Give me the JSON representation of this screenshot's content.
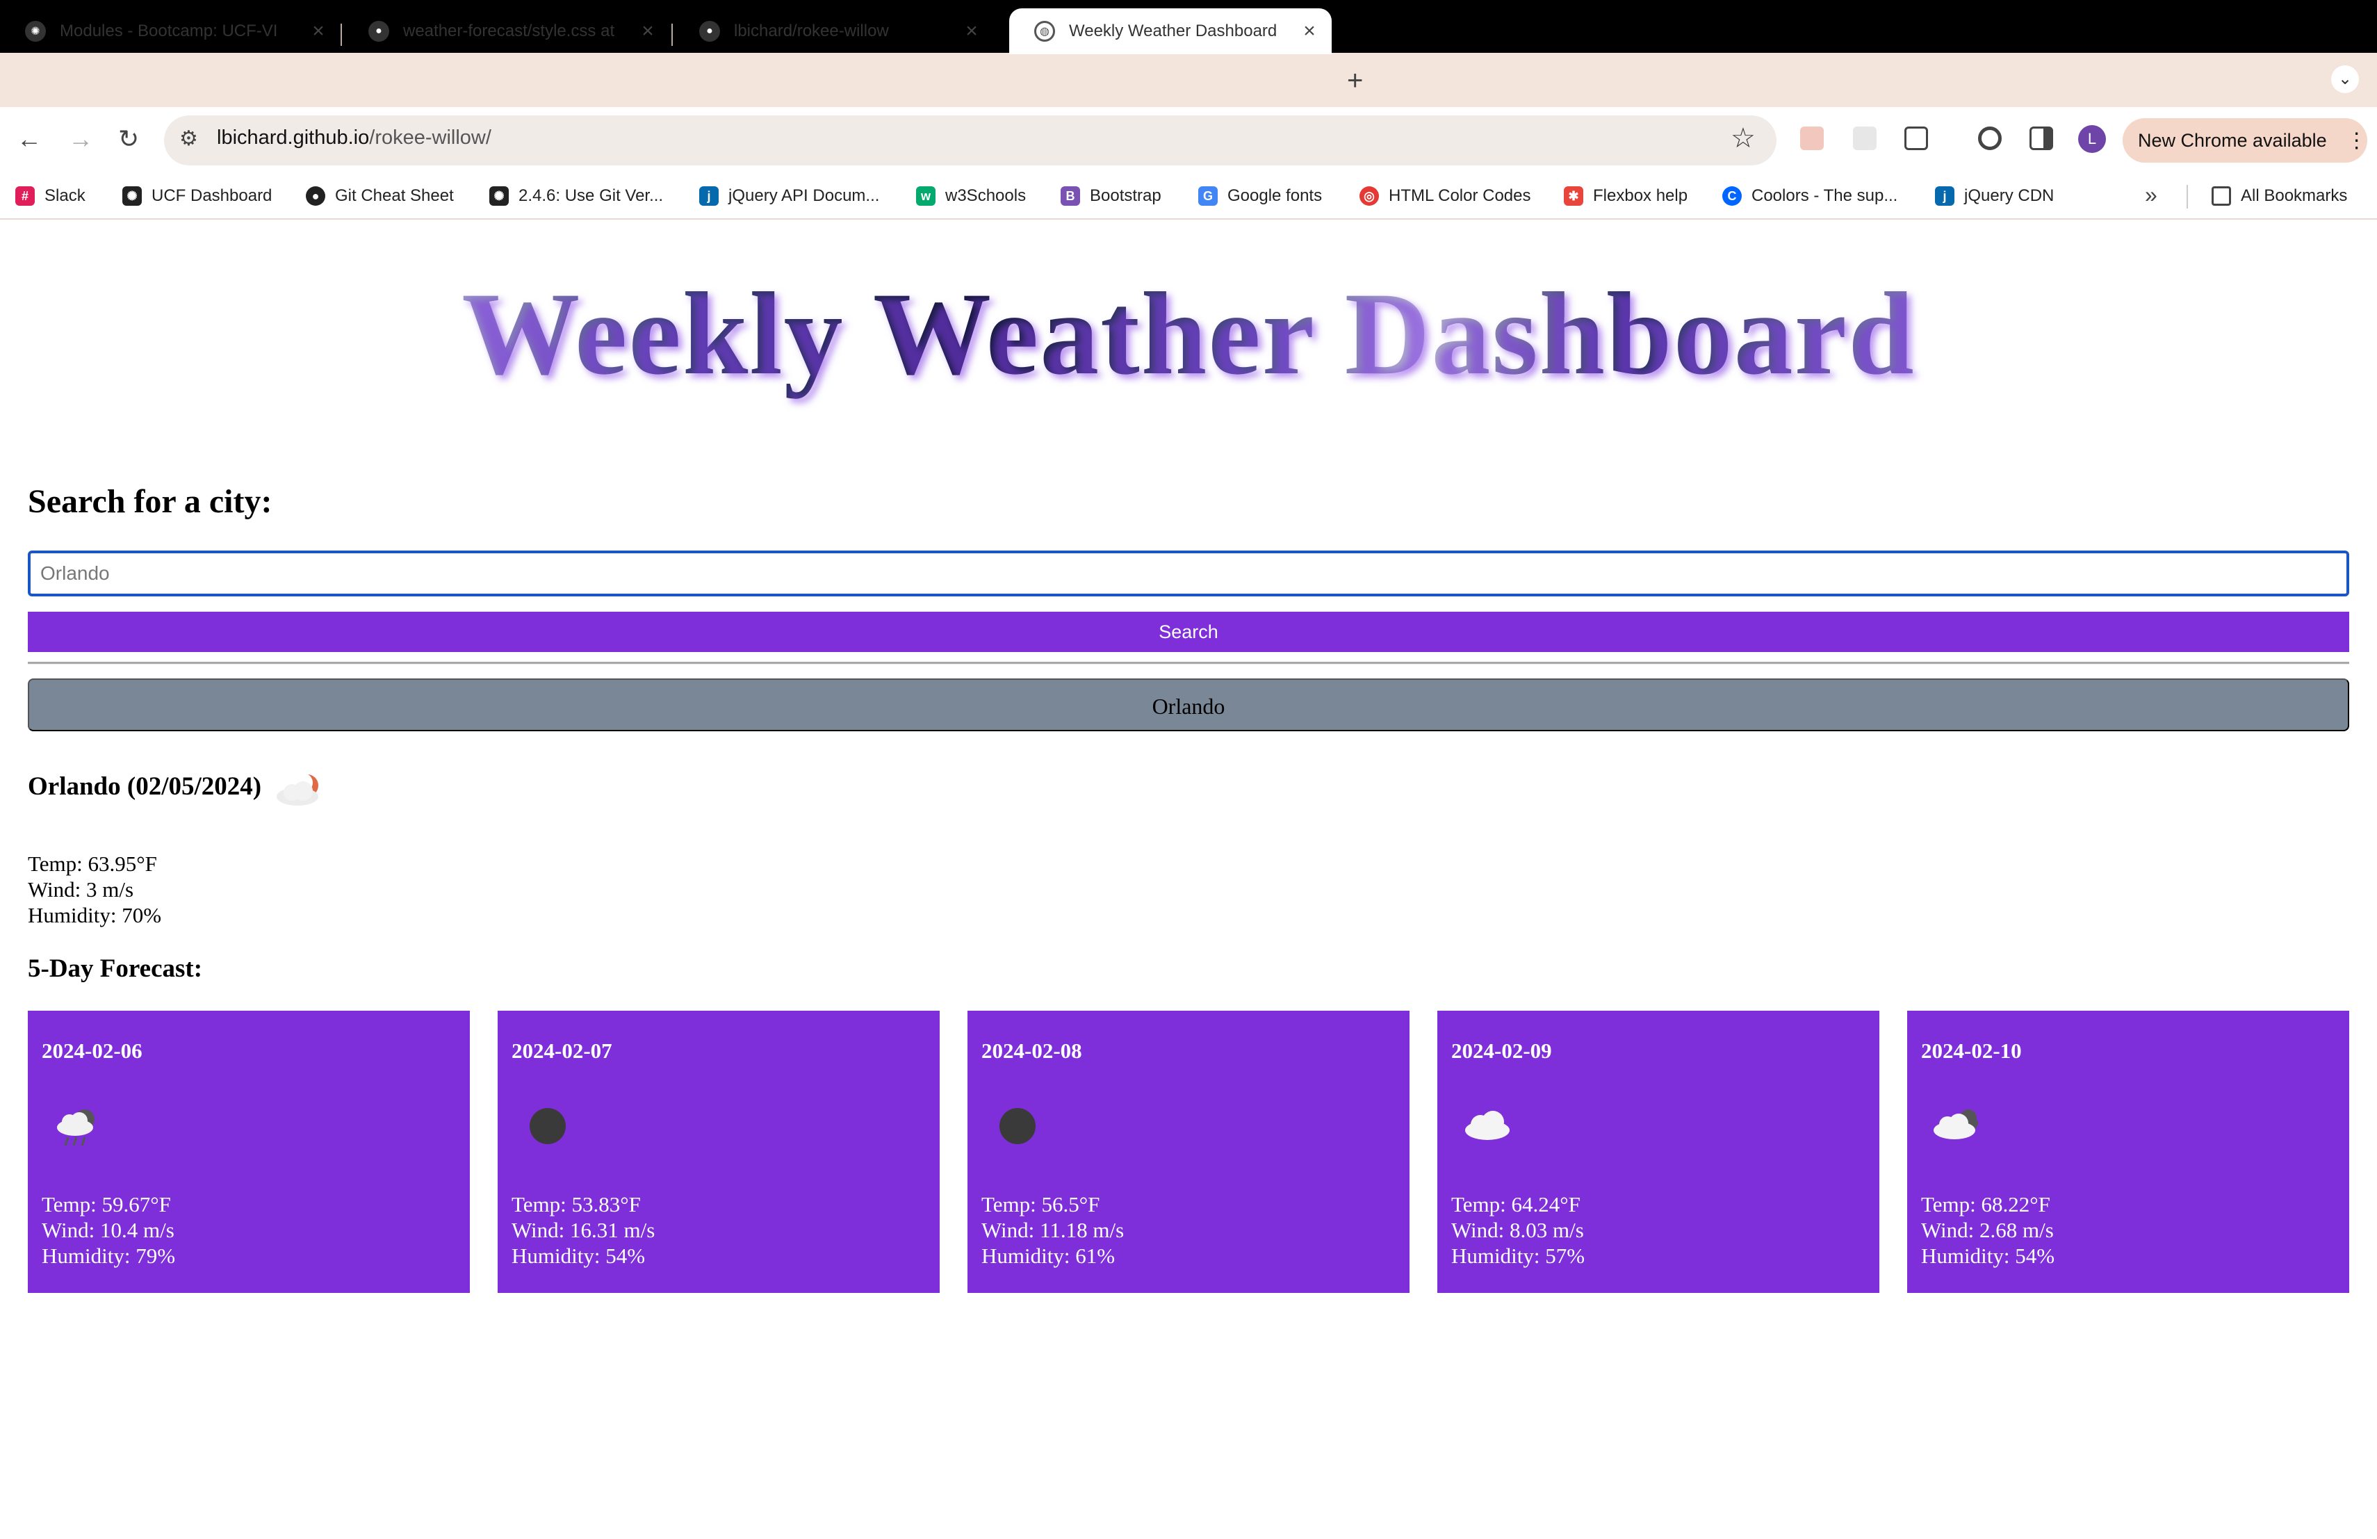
{
  "browser": {
    "tabs": [
      {
        "title": "Modules - Bootcamp: UCF-VI",
        "active": false
      },
      {
        "title": "weather-forecast/style.css at",
        "active": false
      },
      {
        "title": "lbichard/rokee-willow",
        "active": false
      },
      {
        "title": "Weekly Weather Dashboard",
        "active": true
      }
    ],
    "url_domain": "lbichard.github.io",
    "url_path": "/rokee-willow/",
    "update_label": "New Chrome available",
    "avatar_letter": "L",
    "bookmarks": [
      {
        "label": "Slack",
        "icon": "slack-icon",
        "color": "#e01e5a"
      },
      {
        "label": "UCF Dashboard",
        "icon": "canvas-icon",
        "color": "#222222"
      },
      {
        "label": "Git Cheat Sheet",
        "icon": "github-icon",
        "color": "#222222"
      },
      {
        "label": "2.4.6: Use Git Ver...",
        "icon": "canvas-icon",
        "color": "#222222"
      },
      {
        "label": "jQuery API Docum...",
        "icon": "jquery-icon",
        "color": "#0769ad"
      },
      {
        "label": "w3Schools",
        "icon": "w3schools-icon",
        "color": "#04aa6d"
      },
      {
        "label": "Bootstrap",
        "icon": "bootstrap-icon",
        "color": "#7952b3"
      },
      {
        "label": "Google fonts",
        "icon": "google-fonts-icon",
        "color": "#4285f4"
      },
      {
        "label": "HTML Color Codes",
        "icon": "color-wheel-icon",
        "color": "#e53935"
      },
      {
        "label": "Flexbox help",
        "icon": "asterisk-icon",
        "color": "#e8453c"
      },
      {
        "label": "Coolors - The sup...",
        "icon": "coolors-icon",
        "color": "#0066ff"
      },
      {
        "label": "jQuery CDN",
        "icon": "jquery-icon",
        "color": "#0769ad"
      }
    ],
    "all_bookmarks_label": "All Bookmarks"
  },
  "page": {
    "title": "Weekly Weather Dashboard",
    "search_heading": "Search for a city:",
    "search_placeholder": "Orlando",
    "search_button": "Search",
    "history": [
      "Orlando"
    ],
    "current": {
      "heading": "Orlando (02/05/2024)",
      "icon": "partly-cloudy-night-icon",
      "temp": "Temp: 63.95°F",
      "wind": "Wind: 3 m/s",
      "humidity": "Humidity: 70%"
    },
    "forecast_heading": "5-Day Forecast:",
    "forecast": [
      {
        "date": "2024-02-06",
        "icon": "rain-cloud-icon",
        "temp": "Temp: 59.67°F",
        "wind": "Wind: 10.4 m/s",
        "humidity": "Humidity: 79%"
      },
      {
        "date": "2024-02-07",
        "icon": "clear-night-icon",
        "temp": "Temp: 53.83°F",
        "wind": "Wind: 16.31 m/s",
        "humidity": "Humidity: 54%"
      },
      {
        "date": "2024-02-08",
        "icon": "clear-night-icon",
        "temp": "Temp: 56.5°F",
        "wind": "Wind: 11.18 m/s",
        "humidity": "Humidity: 61%"
      },
      {
        "date": "2024-02-09",
        "icon": "cloud-icon",
        "temp": "Temp: 64.24°F",
        "wind": "Wind: 8.03 m/s",
        "humidity": "Humidity: 57%"
      },
      {
        "date": "2024-02-10",
        "icon": "broken-clouds-icon",
        "temp": "Temp: 68.22°F",
        "wind": "Wind: 2.68 m/s",
        "humidity": "Humidity: 54%"
      }
    ],
    "colors": {
      "accent": "#7f2fd9",
      "history_button": "#7a8797",
      "input_focus": "#1a56c4"
    }
  }
}
